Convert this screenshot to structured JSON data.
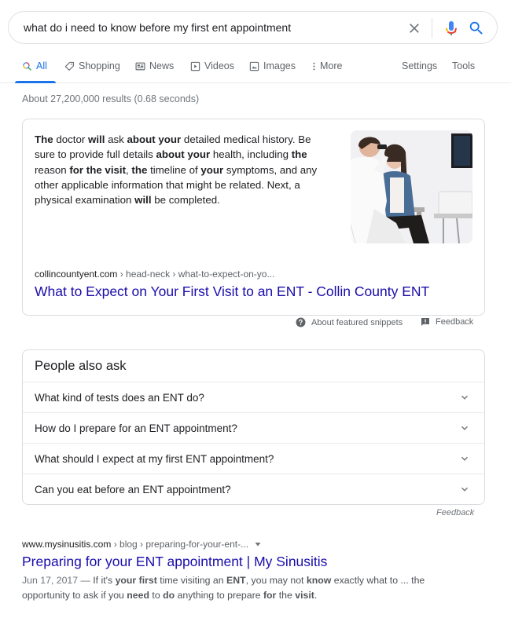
{
  "search": {
    "query": "what do i need to know before my first ent appointment",
    "icons": [
      "close-icon",
      "microphone-icon",
      "search-icon"
    ]
  },
  "tabs": [
    {
      "label": "All",
      "icon": "search-icon",
      "active": true
    },
    {
      "label": "Shopping",
      "icon": "tag-icon"
    },
    {
      "label": "News",
      "icon": "newspaper-icon"
    },
    {
      "label": "Videos",
      "icon": "play-icon"
    },
    {
      "label": "Images",
      "icon": "image-icon"
    },
    {
      "label": "More",
      "icon": "more-vert-icon"
    }
  ],
  "tools": {
    "settings": "Settings",
    "tools": "Tools"
  },
  "result_stats": "About 27,200,000 results (0.68 seconds)",
  "featured_snippet": {
    "segments": [
      {
        "t": "The",
        "b": true
      },
      {
        "t": " doctor "
      },
      {
        "t": "will",
        "b": true
      },
      {
        "t": " ask "
      },
      {
        "t": "about your",
        "b": true
      },
      {
        "t": " detailed medical history. Be sure to provide full details "
      },
      {
        "t": "about your",
        "b": true
      },
      {
        "t": " health, including "
      },
      {
        "t": "the",
        "b": true
      },
      {
        "t": " reason "
      },
      {
        "t": "for the visit",
        "b": true
      },
      {
        "t": ", "
      },
      {
        "t": "the",
        "b": true
      },
      {
        "t": " timeline of "
      },
      {
        "t": "your",
        "b": true
      },
      {
        "t": " symptoms, and any other applicable information that might be related. Next, a physical examination "
      },
      {
        "t": "will",
        "b": true
      },
      {
        "t": " be completed."
      }
    ],
    "image_alt": "Doctor examining patient's ear",
    "site": "collincountyent.com",
    "breadcrumb": " › head-neck › what-to-expect-on-yo...",
    "title": "What to Expect on Your First Visit to an ENT - Collin County ENT",
    "about_label": "About featured snippets",
    "feedback_label": "Feedback"
  },
  "people_also_ask": {
    "heading": "People also ask",
    "questions": [
      "What kind of tests does an ENT do?",
      "How do I prepare for an ENT appointment?",
      "What should I expect at my first ENT appointment?",
      "Can you eat before an ENT appointment?"
    ],
    "feedback_label": "Feedback"
  },
  "result": {
    "site": "www.mysinusitis.com",
    "breadcrumb": " › blog › preparing-for-your-ent-...",
    "title": "Preparing for your ENT appointment | My Sinusitis",
    "date": "Jun 17, 2017 — ",
    "segments": [
      {
        "t": "If it's "
      },
      {
        "t": "your first",
        "b": true
      },
      {
        "t": " time visiting an "
      },
      {
        "t": "ENT",
        "b": true
      },
      {
        "t": ", you may not "
      },
      {
        "t": "know",
        "b": true
      },
      {
        "t": " exactly what to ... the opportunity to ask if you "
      },
      {
        "t": "need",
        "b": true
      },
      {
        "t": " to "
      },
      {
        "t": "do",
        "b": true
      },
      {
        "t": " anything to prepare "
      },
      {
        "t": "for",
        "b": true
      },
      {
        "t": " the "
      },
      {
        "t": "visit",
        "b": true
      },
      {
        "t": "."
      }
    ]
  },
  "colors": {
    "link": "#1a0dab",
    "accent": "#1a73e8",
    "secondary_text": "#70757a",
    "border": "#dadce0"
  }
}
